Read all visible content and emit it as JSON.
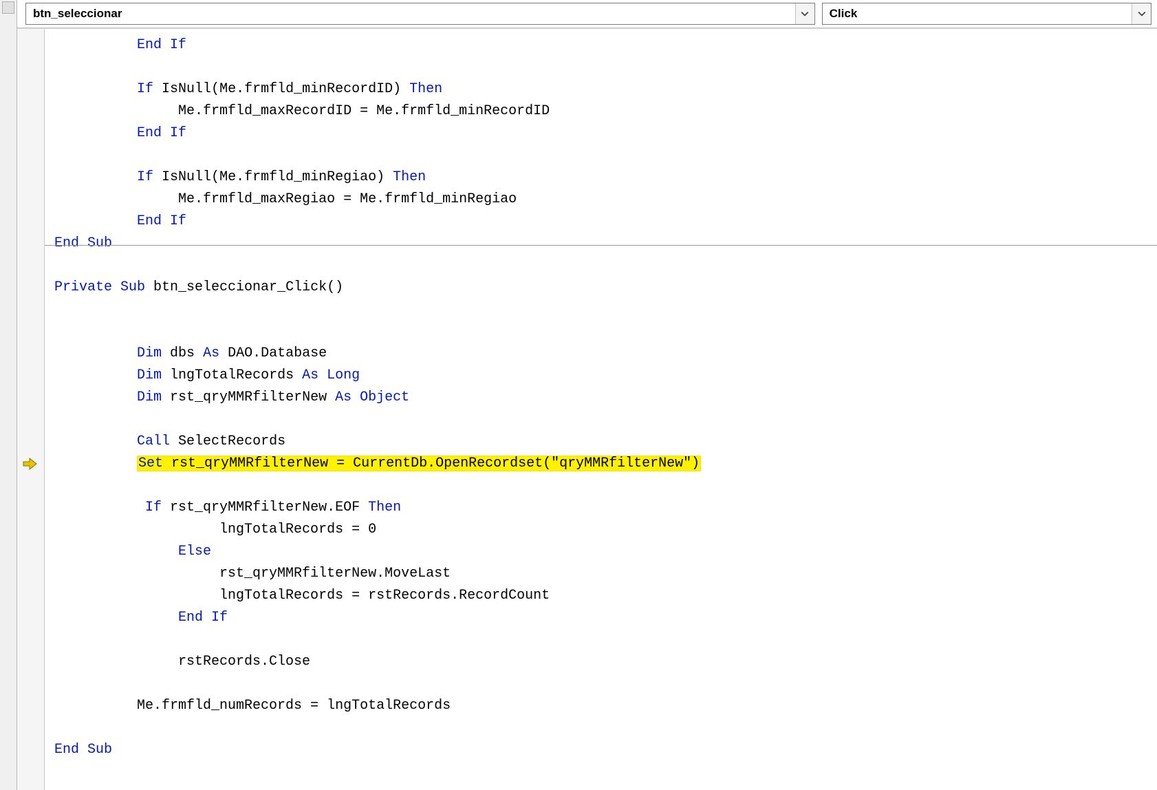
{
  "toolbar": {
    "object_dropdown": "btn_seleccionar",
    "event_dropdown": "Click"
  },
  "gutter": {
    "current_line_icon": "execution-pointer"
  },
  "code": {
    "highlighted_line_index": 19,
    "proc_separator_after_line": 9,
    "lines": [
      {
        "indent": 2,
        "segs": [
          {
            "t": "End If",
            "k": true
          }
        ]
      },
      {
        "indent": 0,
        "segs": [
          {
            "t": ""
          }
        ]
      },
      {
        "indent": 2,
        "segs": [
          {
            "t": "If",
            "k": true
          },
          {
            "t": " IsNull(Me.frmfld_minRecordID) "
          },
          {
            "t": "Then",
            "k": true
          }
        ]
      },
      {
        "indent": 3,
        "segs": [
          {
            "t": "Me.frmfld_maxRecordID = Me.frmfld_minRecordID"
          }
        ]
      },
      {
        "indent": 2,
        "segs": [
          {
            "t": "End If",
            "k": true
          }
        ]
      },
      {
        "indent": 0,
        "segs": [
          {
            "t": ""
          }
        ]
      },
      {
        "indent": 2,
        "segs": [
          {
            "t": "If",
            "k": true
          },
          {
            "t": " IsNull(Me.frmfld_minRegiao) "
          },
          {
            "t": "Then",
            "k": true
          }
        ]
      },
      {
        "indent": 3,
        "segs": [
          {
            "t": "Me.frmfld_maxRegiao = Me.frmfld_minRegiao"
          }
        ]
      },
      {
        "indent": 2,
        "segs": [
          {
            "t": "End If",
            "k": true
          }
        ]
      },
      {
        "indent": 0,
        "segs": [
          {
            "t": "End Sub",
            "k": true
          }
        ]
      },
      {
        "indent": 0,
        "segs": [
          {
            "t": ""
          }
        ]
      },
      {
        "indent": 0,
        "segs": [
          {
            "t": "Private Sub",
            "k": true
          },
          {
            "t": " btn_seleccionar_Click()"
          }
        ]
      },
      {
        "indent": 0,
        "segs": [
          {
            "t": ""
          }
        ]
      },
      {
        "indent": 0,
        "segs": [
          {
            "t": ""
          }
        ]
      },
      {
        "indent": 2,
        "segs": [
          {
            "t": "Dim",
            "k": true
          },
          {
            "t": " dbs "
          },
          {
            "t": "As",
            "k": true
          },
          {
            "t": " DAO.Database"
          }
        ]
      },
      {
        "indent": 2,
        "segs": [
          {
            "t": "Dim",
            "k": true
          },
          {
            "t": " lngTotalRecords "
          },
          {
            "t": "As Long",
            "k": true
          }
        ]
      },
      {
        "indent": 2,
        "segs": [
          {
            "t": "Dim",
            "k": true
          },
          {
            "t": " rst_qryMMRfilterNew "
          },
          {
            "t": "As Object",
            "k": true
          }
        ]
      },
      {
        "indent": 0,
        "segs": [
          {
            "t": ""
          }
        ]
      },
      {
        "indent": 2,
        "segs": [
          {
            "t": "Call",
            "k": true
          },
          {
            "t": " SelectRecords"
          }
        ]
      },
      {
        "indent": 2,
        "hl": true,
        "segs": [
          {
            "t": "Set",
            "k": true
          },
          {
            "t": " rst_qryMMRfilterNew = CurrentDb.OpenRecordset(\"qryMMRfilterNew\")"
          }
        ]
      },
      {
        "indent": 0,
        "segs": [
          {
            "t": ""
          }
        ]
      },
      {
        "indent": 2,
        "extra_space": 1,
        "segs": [
          {
            "t": "If",
            "k": true
          },
          {
            "t": " rst_qryMMRfilterNew.EOF "
          },
          {
            "t": "Then",
            "k": true
          }
        ]
      },
      {
        "indent": 4,
        "segs": [
          {
            "t": "lngTotalRecords = 0"
          }
        ]
      },
      {
        "indent": 3,
        "segs": [
          {
            "t": "Else",
            "k": true
          }
        ]
      },
      {
        "indent": 4,
        "segs": [
          {
            "t": "rst_qryMMRfilterNew.MoveLast"
          }
        ]
      },
      {
        "indent": 4,
        "segs": [
          {
            "t": "lngTotalRecords = rstRecords.RecordCount"
          }
        ]
      },
      {
        "indent": 3,
        "segs": [
          {
            "t": "End If",
            "k": true
          }
        ]
      },
      {
        "indent": 0,
        "segs": [
          {
            "t": ""
          }
        ]
      },
      {
        "indent": 3,
        "segs": [
          {
            "t": "rstRecords.Close"
          }
        ]
      },
      {
        "indent": 0,
        "segs": [
          {
            "t": ""
          }
        ]
      },
      {
        "indent": 2,
        "segs": [
          {
            "t": "Me.frmfld_numRecords = lngTotalRecords"
          }
        ]
      },
      {
        "indent": 0,
        "segs": [
          {
            "t": ""
          }
        ]
      },
      {
        "indent": 0,
        "segs": [
          {
            "t": "End Sub",
            "k": true
          }
        ]
      }
    ]
  }
}
